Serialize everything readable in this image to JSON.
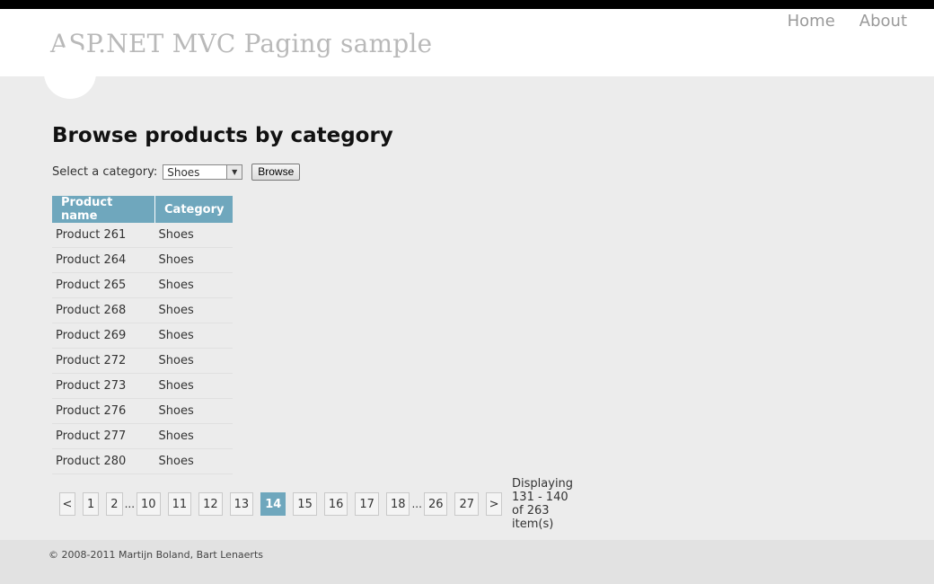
{
  "header": {
    "title": "ASP.NET MVC Paging sample",
    "nav": [
      "Home",
      "About"
    ]
  },
  "main": {
    "heading": "Browse products by category",
    "filter_label": "Select a category:",
    "category_value": "Shoes",
    "browse_label": "Browse",
    "columns": [
      "Product name",
      "Category"
    ],
    "rows": [
      [
        "Product 261",
        "Shoes"
      ],
      [
        "Product 264",
        "Shoes"
      ],
      [
        "Product 265",
        "Shoes"
      ],
      [
        "Product 268",
        "Shoes"
      ],
      [
        "Product 269",
        "Shoes"
      ],
      [
        "Product 272",
        "Shoes"
      ],
      [
        "Product 273",
        "Shoes"
      ],
      [
        "Product 276",
        "Shoes"
      ],
      [
        "Product 277",
        "Shoes"
      ],
      [
        "Product 280",
        "Shoes"
      ]
    ]
  },
  "pager": {
    "prev": "<",
    "next": ">",
    "ellipsis": "...",
    "pages": [
      "1",
      "2",
      "...",
      "10",
      "11",
      "12",
      "13",
      "14",
      "15",
      "16",
      "17",
      "18",
      "...",
      "26",
      "27"
    ],
    "current": "14",
    "status": "Displaying 131 - 140 of 263 item(s)"
  },
  "footer": {
    "text": "© 2008-2011 Martijn Boland, Bart Lenaerts"
  },
  "colors": {
    "accent": "#6fa7bd",
    "background": "#ececec",
    "topbar": "#000000"
  }
}
